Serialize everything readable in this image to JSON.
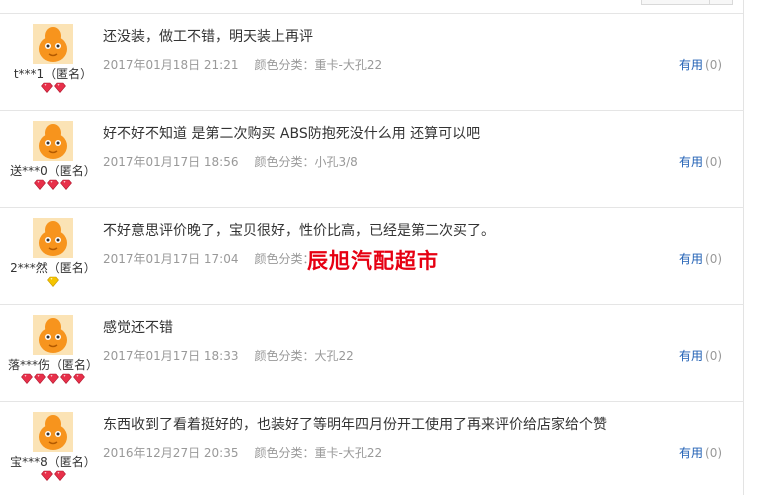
{
  "reviews": [
    {
      "user": "t***1（匿名）",
      "badge_count": 2,
      "badge_type": "red-gem-icon",
      "content": "还没装，做工不错，明天装上再评",
      "date": "2017年01月18日 21:21",
      "sku": "颜色分类：重卡-大孔22",
      "useful_label": "有用",
      "useful_count": "(0)"
    },
    {
      "user": "送***0（匿名）",
      "badge_count": 3,
      "badge_type": "red-gem-icon",
      "content": "好不好不知道 是第二次购买 ABS防抱死没什么用 还算可以吧",
      "date": "2017年01月17日 18:56",
      "sku": "颜色分类：小孔3/8",
      "useful_label": "有用",
      "useful_count": "(0)"
    },
    {
      "user": "2***然（匿名）",
      "badge_count": 1,
      "badge_type": "yellow-diamond-icon",
      "content": "不好意思评价晚了，宝贝很好，性价比高，已经是第二次买了。",
      "date": "2017年01月17日 17:04",
      "sku": "颜色分类：",
      "useful_label": "有用",
      "useful_count": "(0)"
    },
    {
      "user": "落***伤（匿名）",
      "badge_count": 5,
      "badge_type": "red-gem-icon",
      "content": "感觉还不错",
      "date": "2017年01月17日 18:33",
      "sku": "颜色分类：大孔22",
      "useful_label": "有用",
      "useful_count": "(0)"
    },
    {
      "user": "宝***8（匿名）",
      "badge_count": 2,
      "badge_type": "red-gem-icon",
      "content": "东西收到了看着挺好的，也装好了等明年四月份开工使用了再来评价给店家给个赞",
      "date": "2016年12月27日 20:35",
      "sku": "颜色分类：重卡-大孔22",
      "useful_label": "有用",
      "useful_count": "(0)"
    }
  ],
  "watermark": "辰旭汽配超市",
  "colors": {
    "useful_link": "#1f5fb4",
    "meta_text": "#999999",
    "watermark": "#e60012",
    "avatar_orange": "#f7941d"
  }
}
